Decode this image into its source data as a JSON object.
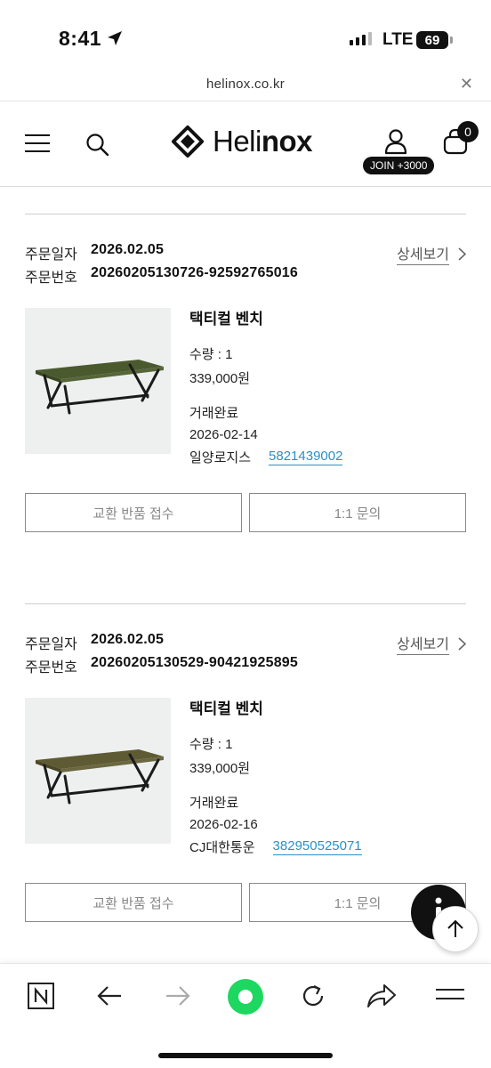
{
  "status_bar": {
    "time": "8:41",
    "network": "LTE",
    "battery": "69"
  },
  "url_bar": {
    "url": "helinox.co.kr",
    "close_icon": "close-icon"
  },
  "header": {
    "logo_text_light": "Heli",
    "logo_text_bold": "nox",
    "join_label": "JOIN +3000",
    "cart_count": "0",
    "icons": [
      "menu-icon",
      "search-icon",
      "user-icon",
      "cart-icon"
    ]
  },
  "orders": [
    {
      "date_label": "주문일자",
      "date": "2026.02.05",
      "number_label": "주문번호",
      "number": "20260205130726-92592765016",
      "detail_label": "상세보기",
      "product_name": "택티컬 벤치",
      "quantity": "수량 : 1",
      "price": "339,000원",
      "status": "거래완료",
      "status_date": "2026-02-14",
      "carrier": "일양로지스",
      "tracking": "5821439002",
      "btn_exchange": "교환 반품 접수",
      "btn_inquiry": "1:1 문의"
    },
    {
      "date_label": "주문일자",
      "date": "2026.02.05",
      "number_label": "주문번호",
      "number": "20260205130529-90421925895",
      "detail_label": "상세보기",
      "product_name": "택티컬 벤치",
      "quantity": "수량 : 1",
      "price": "339,000원",
      "status": "거래완료",
      "status_date": "2026-02-16",
      "carrier": "CJ대한통운",
      "tracking": "382950525071",
      "btn_exchange": "교환 반품 접수",
      "btn_inquiry": "1:1 문의"
    }
  ],
  "colors": {
    "accent_link": "#2a8fc7",
    "record_button": "#1ed760"
  },
  "bottom_bar": {
    "icons": [
      "naver-n-icon",
      "back-arrow-icon",
      "forward-arrow-icon",
      "record-icon",
      "reload-icon",
      "share-icon",
      "menu-icon"
    ]
  }
}
